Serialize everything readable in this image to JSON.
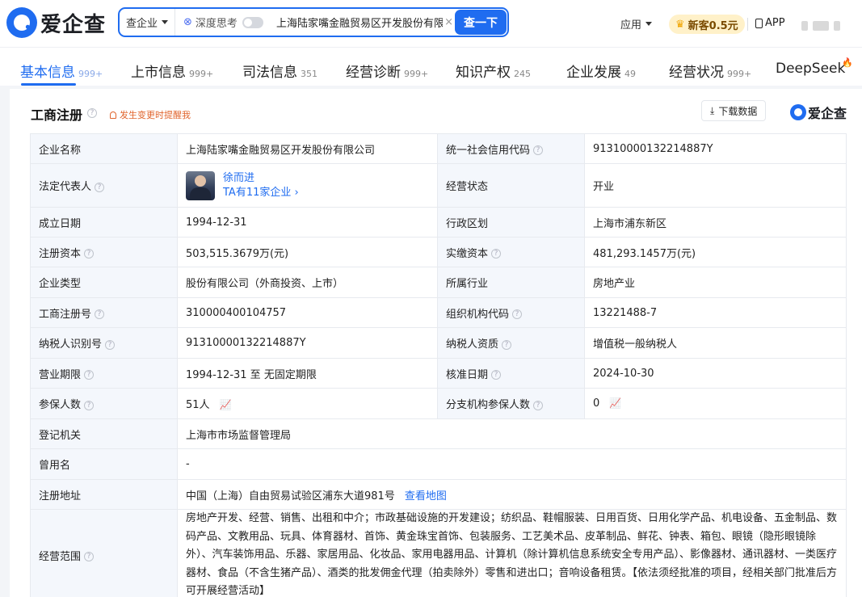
{
  "header": {
    "logo_text": "爱企查",
    "search": {
      "category": "查企业",
      "deep_think_label": "深度思考",
      "query": "上海陆家嘴金融贸易区开发股份有限公司",
      "button": "查一下"
    },
    "apps_label": "应用",
    "promo_label": "新客0.5元",
    "app_label": "APP"
  },
  "tabs": [
    {
      "label": "基本信息",
      "count": "999+"
    },
    {
      "label": "上市信息",
      "count": "999+"
    },
    {
      "label": "司法信息",
      "count": "351"
    },
    {
      "label": "经营诊断",
      "count": "999+"
    },
    {
      "label": "知识产权",
      "count": "245"
    },
    {
      "label": "企业发展",
      "count": "49"
    },
    {
      "label": "经营状况",
      "count": "999+"
    },
    {
      "label": "DeepSeek",
      "count": ""
    }
  ],
  "card": {
    "title": "工商注册",
    "alert": "发生变更时提醒我",
    "download_label": "下载数据",
    "brand": "爱企查"
  },
  "info": {
    "company_name_label": "企业名称",
    "company_name": "上海陆家嘴金融贸易区开发股份有限公司",
    "credit_code_label": "统一社会信用代码",
    "credit_code": "91310000132214887Y",
    "legal_rep_label": "法定代表人",
    "legal_rep_name": "徐而进",
    "legal_rep_sub": "TA有11家企业 ›",
    "status_label": "经营状态",
    "status": "开业",
    "founded_label": "成立日期",
    "founded": "1994-12-31",
    "region_label": "行政区划",
    "region": "上海市浦东新区",
    "reg_capital_label": "注册资本",
    "reg_capital": "503,515.3679万(元)",
    "paid_capital_label": "实缴资本",
    "paid_capital": "481,293.1457万(元)",
    "type_label": "企业类型",
    "type": "股份有限公司（外商投资、上市）",
    "industry_label": "所属行业",
    "industry": "房地产业",
    "reg_no_label": "工商注册号",
    "reg_no": "310000400104757",
    "org_code_label": "组织机构代码",
    "org_code": "13221488-7",
    "tax_id_label": "纳税人识别号",
    "tax_id": "91310000132214887Y",
    "tax_qual_label": "纳税人资质",
    "tax_qual": "增值税一般纳税人",
    "term_label": "营业期限",
    "term": "1994-12-31 至 无固定期限",
    "approval_label": "核准日期",
    "approval": "2024-10-30",
    "insured_label": "参保人数",
    "insured": "51人",
    "branch_insured_label": "分支机构参保人数",
    "branch_insured": "0",
    "authority_label": "登记机关",
    "authority": "上海市市场监督管理局",
    "former_name_label": "曾用名",
    "former_name": "-",
    "address_label": "注册地址",
    "address": "中国（上海）自由贸易试验区浦东大道981号",
    "map_link": "查看地图",
    "scope_label": "经营范围",
    "scope": "房地产开发、经营、销售、出租和中介；市政基础设施的开发建设；纺织品、鞋帽服装、日用百货、日用化学产品、机电设备、五金制品、数码产品、文教用品、玩具、体育器材、首饰、黄金珠宝首饰、包装服务、工艺美术品、皮革制品、鲜花、钟表、箱包、眼镜（隐形眼镜除外）、汽车装饰用品、乐器、家居用品、化妆品、家用电器用品、计算机（除计算机信息系统安全专用产品）、影像器材、通讯器材、一类医疗器材、食品（不含生猪产品）、酒类的批发佣金代理（拍卖除外）零售和进出口；音响设备租赁。【依法须经批准的项目，经相关部门批准后方可开展经营活动】"
  }
}
